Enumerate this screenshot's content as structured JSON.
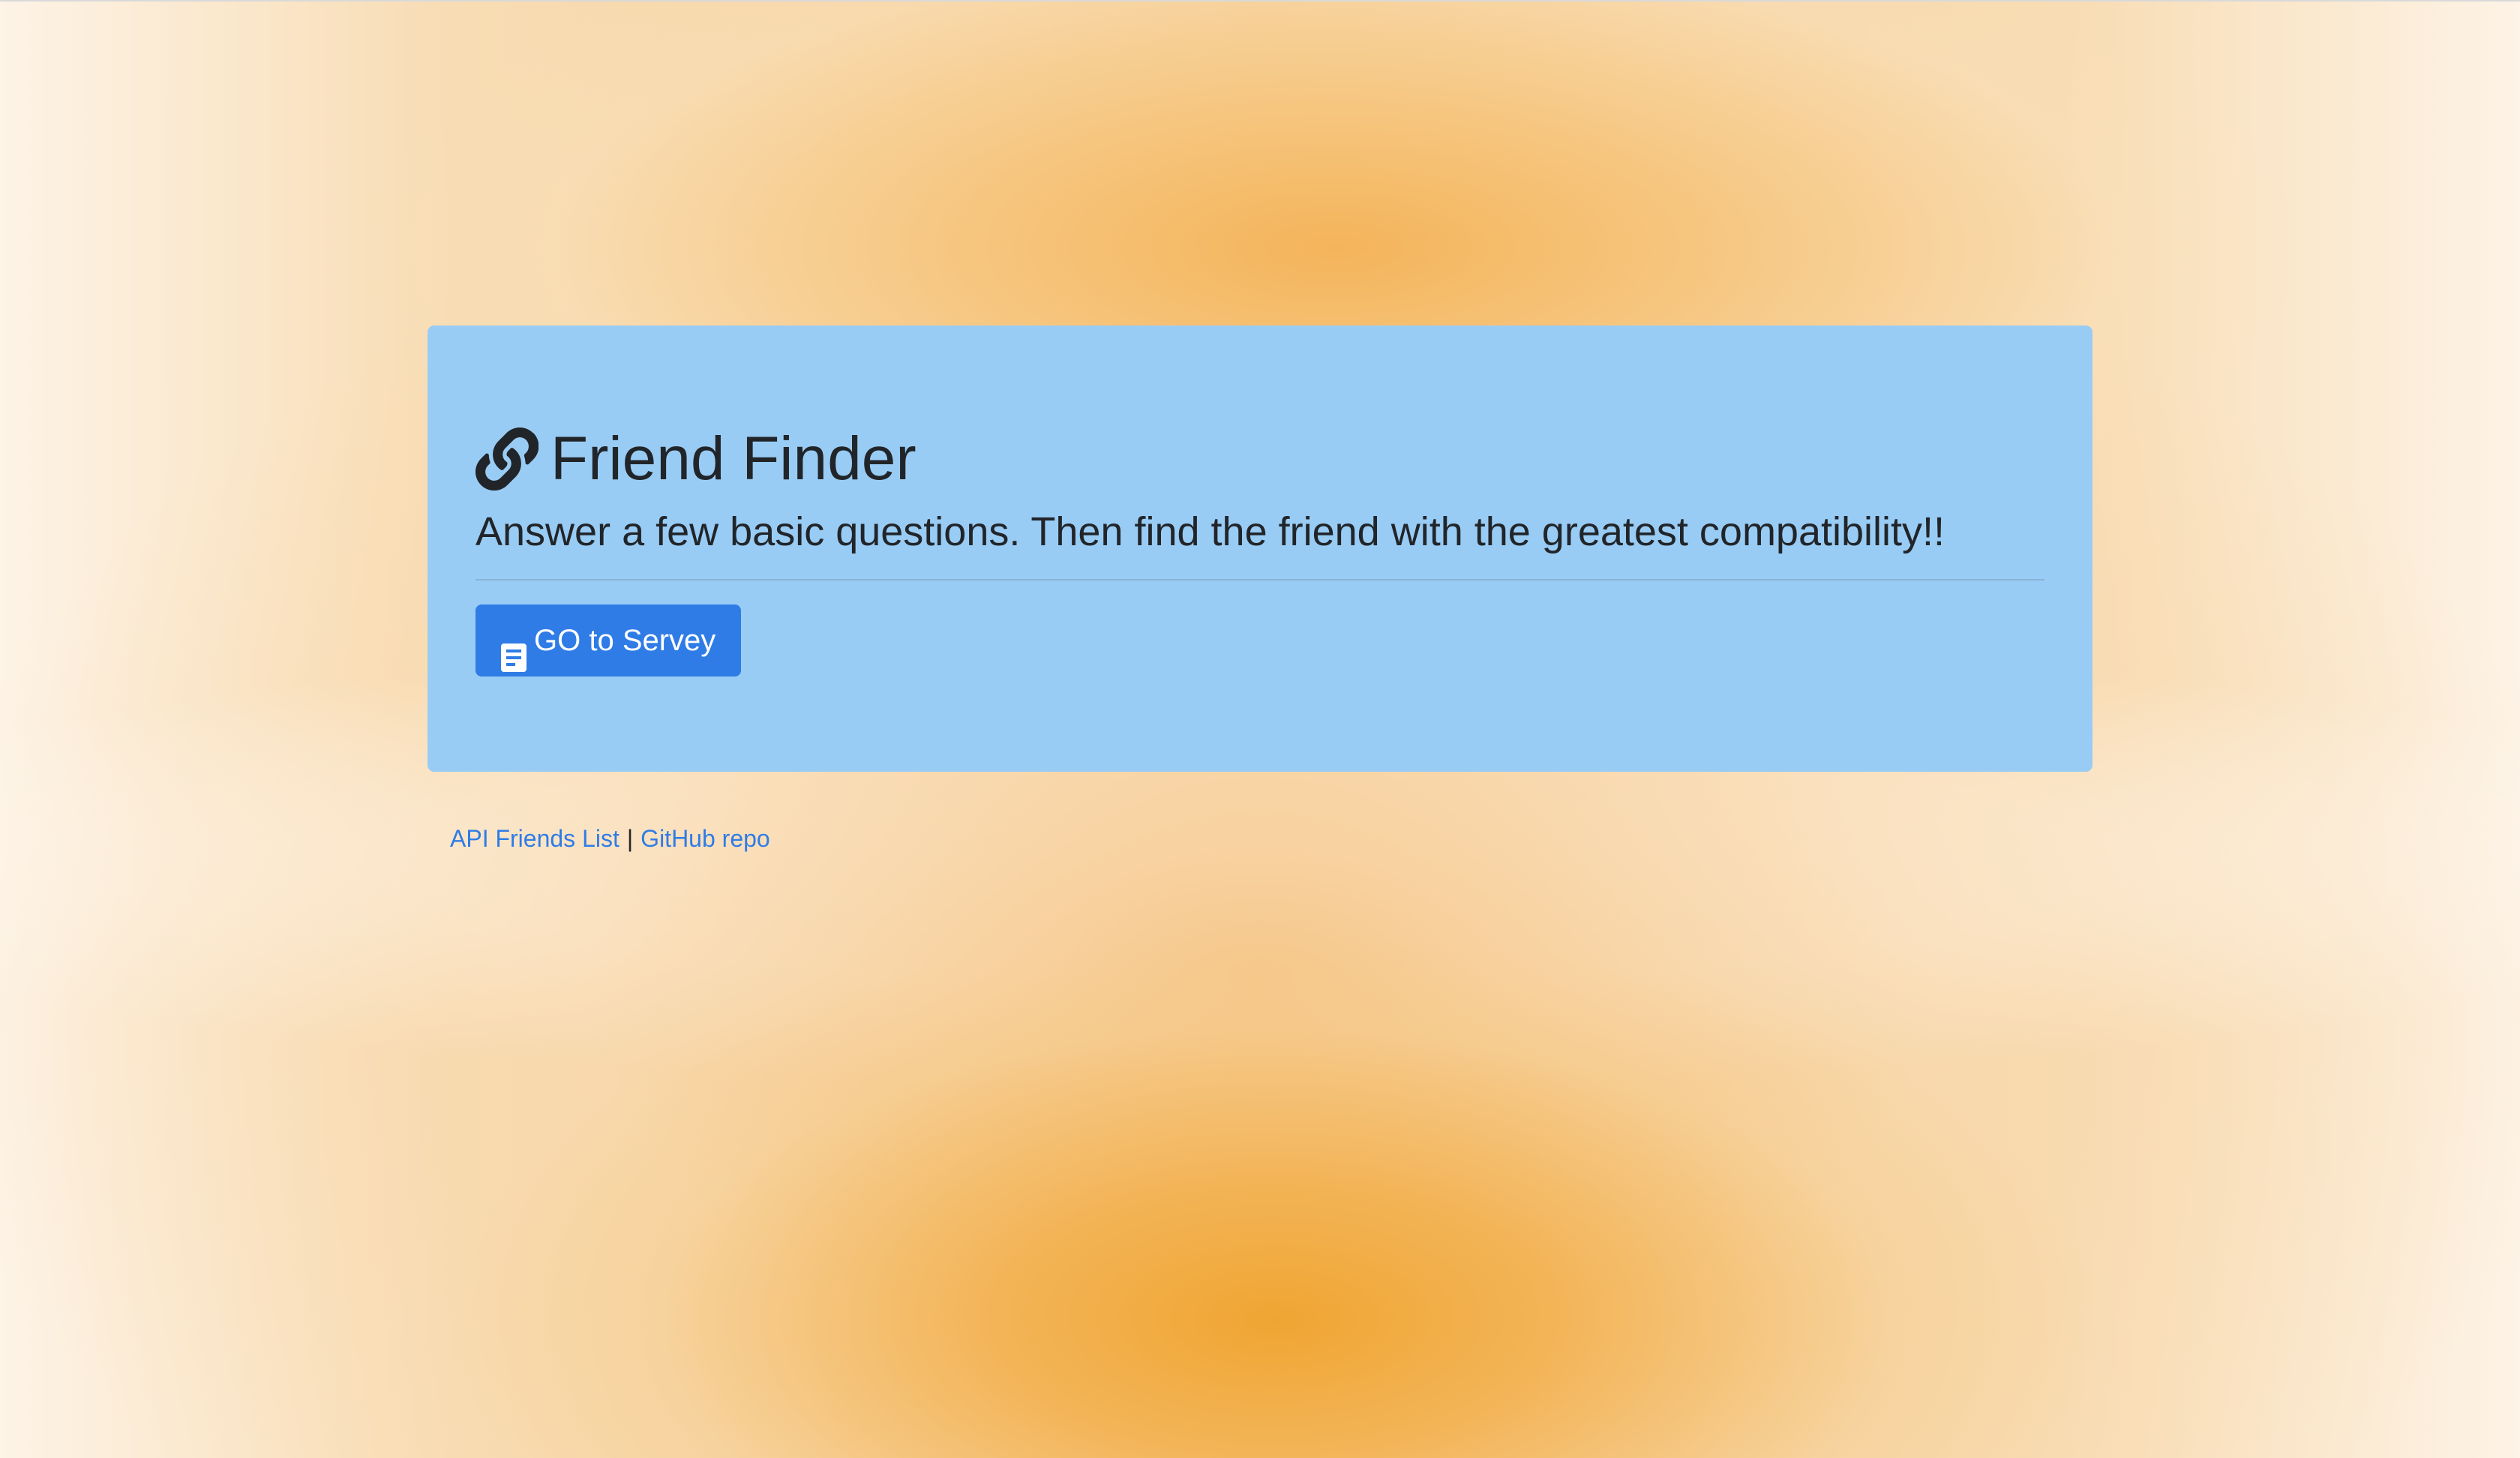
{
  "jumbotron": {
    "title": "Friend Finder",
    "lead": "Answer a few basic questions. Then find the friend with the greatest compatibility!!",
    "title_icon": "link-icon",
    "button": {
      "label": "GO to Servey",
      "icon": "document-icon"
    }
  },
  "footer": {
    "links": [
      {
        "label": "API Friends List"
      },
      {
        "label": "GitHub repo"
      }
    ],
    "separator": "|"
  },
  "colors": {
    "jumbotron_bg": "#99ccf5",
    "button_bg": "#2f7ce6",
    "link": "#2f7ce6",
    "text": "#212529",
    "background_accent": "#f0a532"
  }
}
